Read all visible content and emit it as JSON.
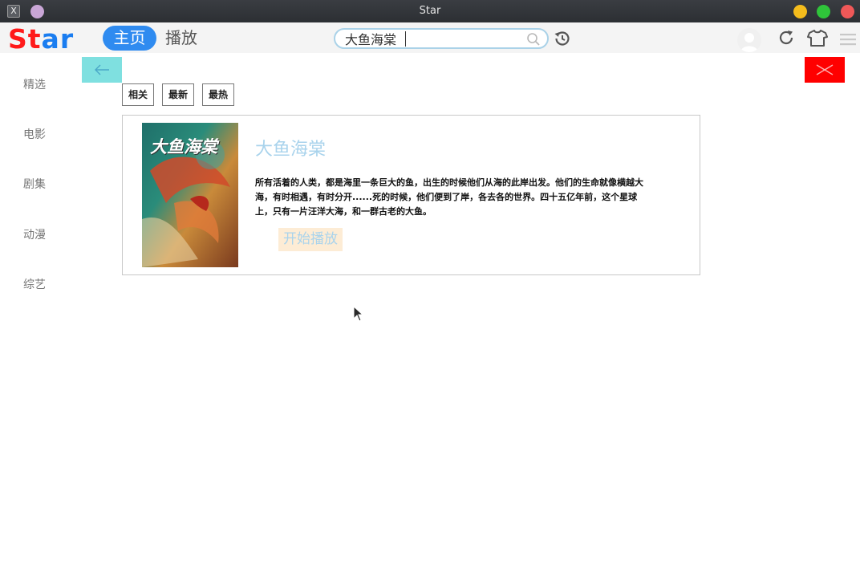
{
  "window": {
    "title": "Star"
  },
  "header": {
    "logo_part1": "St",
    "logo_part2": "ar",
    "nav_home": "主页",
    "nav_play": "播放",
    "search_value": "大鱼海棠"
  },
  "sidebar": {
    "items": [
      {
        "label": "精选"
      },
      {
        "label": "电影"
      },
      {
        "label": "剧集"
      },
      {
        "label": "动漫"
      },
      {
        "label": "综艺"
      }
    ]
  },
  "sort_tabs": [
    {
      "label": "相关"
    },
    {
      "label": "最新"
    },
    {
      "label": "最热"
    }
  ],
  "result": {
    "title": "大鱼海棠",
    "poster_text": "大鱼海棠",
    "description": "所有活着的人类，都是海里一条巨大的鱼，出生的时候他们从海的此岸出发。他们的生命就像横越大海，有时相遇，有时分开......死的时候，他们便到了岸，各去各的世界。四十五亿年前，这个星球上，只有一片汪洋大海，和一群古老的大鱼。",
    "play_label": "开始播放"
  },
  "colors": {
    "home_pill": "#2f8bf0",
    "logo_red": "#ff1a1a",
    "logo_blue": "#1a7df0",
    "back_button": "#7fe0e0",
    "close_button": "#ff0000",
    "title_text": "#a9d3ec",
    "play_button_bg": "#fdecd5"
  },
  "icons": {
    "window_app": "x-app-icon",
    "search": "search-icon",
    "history": "history-icon",
    "refresh": "refresh-icon",
    "skin": "tshirt-icon",
    "menu": "hamburger-menu-icon",
    "back": "arrow-left-icon",
    "close": "close-icon"
  }
}
